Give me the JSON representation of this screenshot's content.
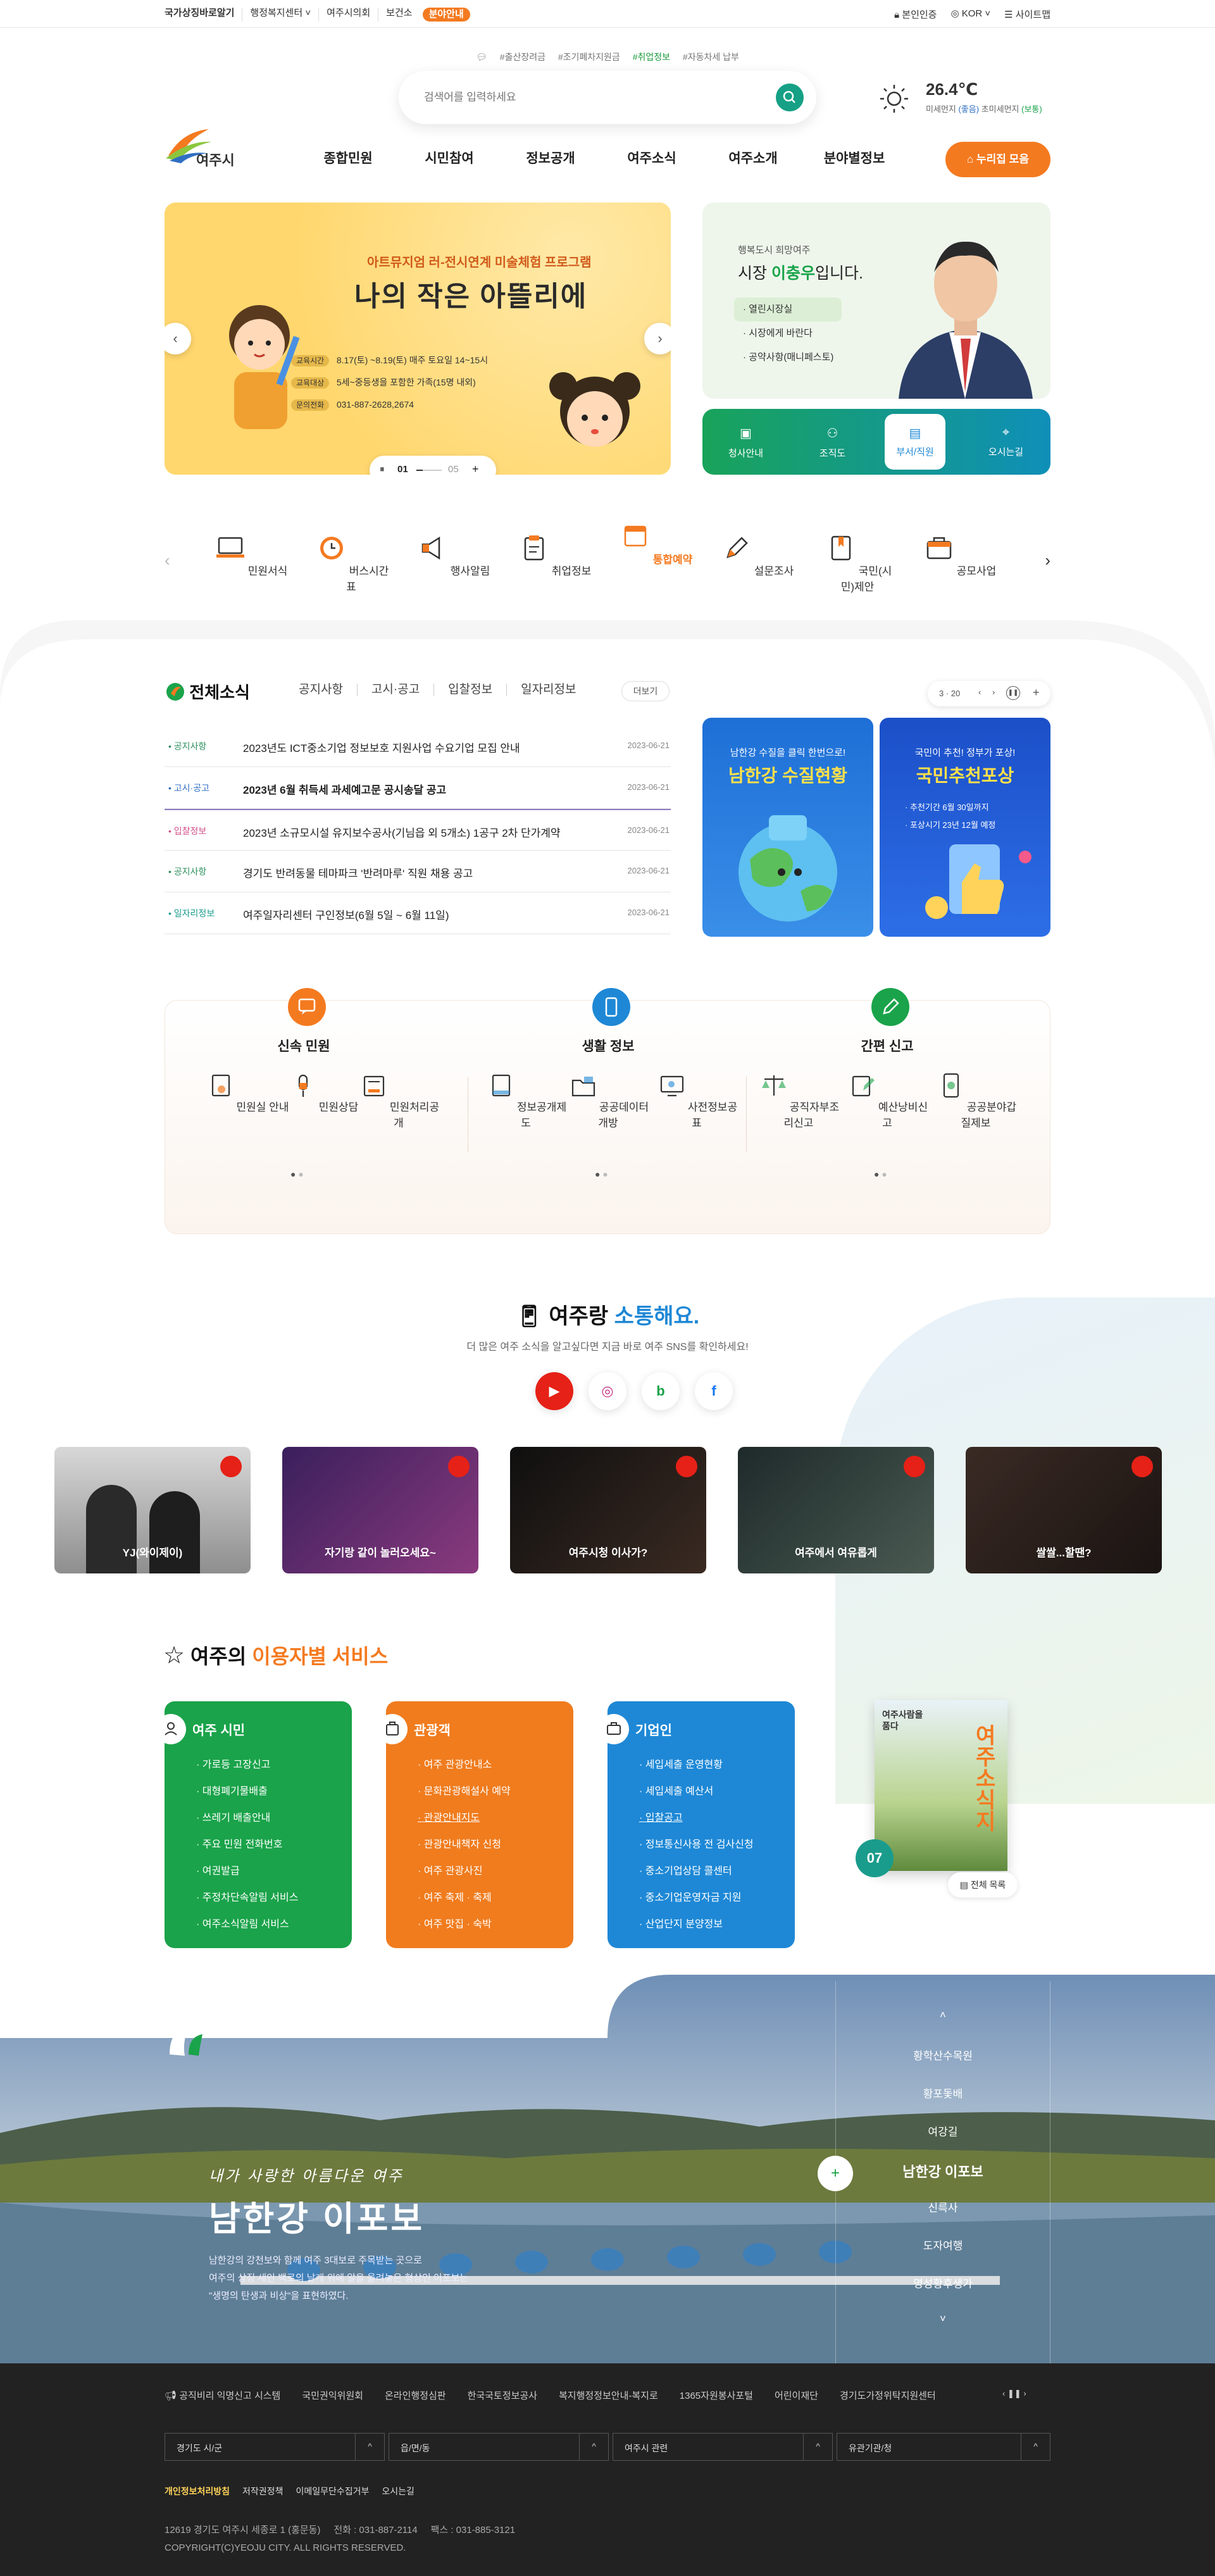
{
  "topbar": {
    "links": [
      "국가상징바로알기",
      "행정복지센터 ˅",
      "여주시의회",
      "보건소"
    ],
    "badge": "분야안내",
    "right": [
      "본인인증",
      "KOR ˅",
      "사이트맵"
    ]
  },
  "search": {
    "tags": [
      "#출산장려금",
      "#조기폐차지원금",
      "#취업정보",
      "#자동차세 납부"
    ],
    "placeholder": "검색어를 입력하세요"
  },
  "weather": {
    "temp": "26.4℃",
    "fine_dust_label": "미세먼지",
    "fine_dust_value": "(좋음)",
    "ultra_dust_label": "초미세먼지",
    "ultra_dust_value": "(보통)"
  },
  "logo": {
    "text": "여주시"
  },
  "nav": [
    "종합민원",
    "시민참여",
    "정보공개",
    "여주소식",
    "여주소개",
    "분야별정보"
  ],
  "member_button": "누리집 모음",
  "banner": {
    "subtitle": "아트뮤지엄 러-전시연계 미술체험 프로그램",
    "title": "나의 작은 아뜰리에",
    "rows": [
      {
        "label": "교육시간",
        "value": "8.17(토) ~8.19(토) 매주 토요일 14~15시"
      },
      {
        "label": "교육대상",
        "value": "5세~중등생을 포함한 가족(15명 내외)"
      },
      {
        "label": "문의전화",
        "value": "031-887-2628,2674"
      }
    ],
    "page_current": "01",
    "page_total": "05"
  },
  "mayor": {
    "tagline": "행복도시 희망여주",
    "title_prefix": "시장",
    "name": "이충우",
    "title_suffix": "입니다.",
    "links": [
      "열린시장실",
      "시장에게 바란다",
      "공약사항(매니페스토)"
    ],
    "menu": [
      "청사안내",
      "조직도",
      "부서/직원",
      "오시는길"
    ]
  },
  "quick": [
    "민원서식",
    "버스시간표",
    "행사알림",
    "취업정보",
    "통합예약",
    "설문조사",
    "국민(시민)제안",
    "공모사업"
  ],
  "news": {
    "title": "전체소식",
    "tabs": [
      "공지사항",
      "고시·공고",
      "입찰정보",
      "일자리정보"
    ],
    "more": "더보기",
    "counter": "3 · 20",
    "rows": [
      {
        "cat": "공지사항",
        "title": "2023년도 ICT중소기업 정보보호 지원사업 수요기업 모집 안내",
        "date": "2023-06-21",
        "color": "#2a8f5c"
      },
      {
        "cat": "고시·공고",
        "title": "2023년 6월 취득세 과세예고문 공시송달 공고",
        "date": "2023-06-21",
        "color": "#2f6fc2"
      },
      {
        "cat": "입찰정보",
        "title": "2023년 소규모시설 유지보수공사(기님읍 외 5개소) 1공구 2차 단가계약",
        "date": "2023-06-21",
        "color": "#d2508a"
      },
      {
        "cat": "공지사항",
        "title": "경기도 반려동물 테마파크 '반려마루' 직원 채용 공고",
        "date": "2023-06-21",
        "color": "#2a8f5c"
      },
      {
        "cat": "일자리정보",
        "title": "여주일자리센터 구인정보(6월 5일 ~ 6월 11일)",
        "date": "2023-06-21",
        "color": "#1a9c8c"
      }
    ],
    "card1": {
      "top": "남한강 수질을 클릭 한번으로!",
      "title": "남한강 수질현황"
    },
    "card2": {
      "top": "국민이 추천! 정부가 포상!",
      "title": "국민추천포상",
      "lines": [
        "추천기간  6월 30일까지",
        "포상시기  23년 12월 예정"
      ]
    }
  },
  "services": [
    {
      "title": "신속 민원",
      "items": [
        "민원실 안내",
        "민원상담",
        "민원처리공개"
      ]
    },
    {
      "title": "생활 정보",
      "items": [
        "정보공개제도",
        "공공데이터개방",
        "사전정보공표"
      ]
    },
    {
      "title": "간편 신고",
      "items": [
        "공직자부조리신고",
        "예산낭비신고",
        "공공분야갑질제보"
      ]
    }
  ],
  "sns": {
    "title_a": "여주랑",
    "title_b": "소통해요.",
    "subtitle": "더 많은 여주 소식을 알고싶다면 지금 바로 여주 SNS를 확인하세요!",
    "videos": [
      "YJ(와이제이)",
      "자기랑 같이 놀러오세요~",
      "여주시청 이사가?",
      "여주에서 여유롭게",
      "쌀쌀...할땐?"
    ]
  },
  "user_services": {
    "title_a": "여주의",
    "title_b": "이용자별 서비스",
    "cards": [
      {
        "title": "여주 시민",
        "items": [
          "가로등 고장신고",
          "대형폐기물배출",
          "쓰레기 배출안내",
          "주요 민원 전화번호",
          "여권발급",
          "주정차단속알림 서비스",
          "여주소식알림 서비스"
        ],
        "color": "#1aa34a"
      },
      {
        "title": "관광객",
        "items": [
          "여주 관광안내소",
          "문화관광해설사 예약",
          "관광안내지도",
          "관광안내책자 신청",
          "여주 관광사진",
          "여주 축제 · 축제",
          "여주 맛집 · 숙박"
        ],
        "color": "#f07c1e"
      },
      {
        "title": "기업인",
        "items": [
          "세입세출 운영현황",
          "세입세출 예산서",
          "입찰공고",
          "정보통신사용 전 검사신청",
          "중소기업상담 콜센터",
          "중소기업운영자금 지원",
          "산업단지 분양정보"
        ],
        "color": "#1e88d6"
      }
    ],
    "magazine_no": "07",
    "magazine_title": "여주사람을 품다",
    "magazine_side": "여주소식지",
    "magazine_btn": "전체 목록"
  },
  "landscape": {
    "handwriting": "내가 사랑한 아름다운 여주",
    "title": "남한강 이포보",
    "desc": [
      "남한강의 강천보와 함께 여주 3대보로 주목받는 곳으로",
      "여주의 상징 새인 백로의 날개 위에 알을 올려놓은 형상인 이포보는",
      "\"생명의 탄생과 비상\"을 표현하였다."
    ],
    "menu": [
      "황학산수목원",
      "황포돛배",
      "여강길",
      "남한강 이포보",
      "신륵사",
      "도자여행",
      "명성황후생가"
    ],
    "active": "남한강 이포보"
  },
  "footer": {
    "links": [
      "공직비리 익명신고 시스템",
      "국민권익위원회",
      "온라인행정심판",
      "한국국토정보공사",
      "복지행정정보안내-복지로",
      "1365자원봉사포털",
      "어린이재단",
      "경기도가정위탁지원센터"
    ],
    "selects": [
      "경기도 시/군",
      "읍/면/동",
      "여주시 관련",
      "유관기관/청"
    ],
    "bottom": [
      "개인정보처리방침",
      "저작권정책",
      "이메일무단수집거부",
      "오시는길"
    ],
    "address": "12619 경기도 여주시 세종로 1 (홍문동)     전화 : 031-887-2114     팩스 : 031-885-3121",
    "copyright": "COPYRIGHT(C)YEOJU CITY. ALL RIGHTS RESERVED."
  },
  "colors": {
    "brand_orange": "#f47a20",
    "brand_green": "#1aa34a",
    "brand_blue": "#1e88d6",
    "footer_bg": "#222222"
  }
}
